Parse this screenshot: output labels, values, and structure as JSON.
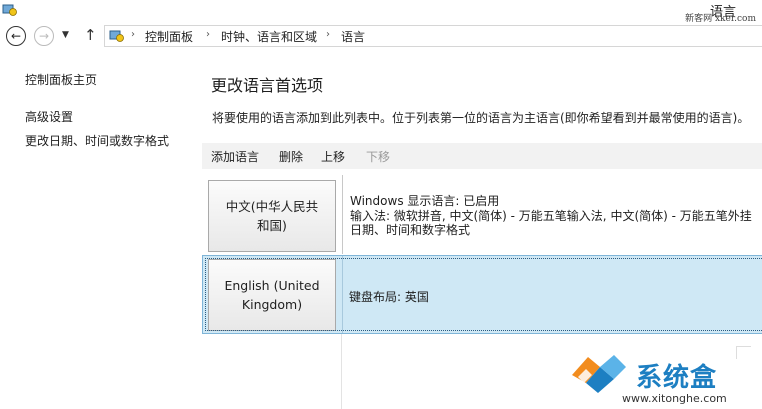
{
  "window": {
    "title": "语言",
    "watermark": "新客网 xker.com"
  },
  "nav": {
    "breadcrumbs": [
      "控制面板",
      "时钟、语言和区域",
      "语言"
    ]
  },
  "sidebar": {
    "home": "控制面板主页",
    "links": [
      "高级设置",
      "更改日期、时间或数字格式"
    ]
  },
  "main": {
    "heading": "更改语言首选项",
    "description": "将要使用的语言添加到此列表中。位于列表第一位的语言为主语言(即你希望看到并最常使用的语言)。",
    "toolbar": {
      "add": "添加语言",
      "remove": "删除",
      "up": "上移",
      "down": "下移"
    },
    "languages": [
      {
        "name_line1": "中文(中华人民共",
        "name_line2": "和国)",
        "info": [
          "Windows 显示语言: 已启用",
          "输入法: 微软拼音, 中文(简体) - 万能五笔输入法, 中文(简体) - 万能五笔外挂",
          "日期、时间和数字格式"
        ],
        "selected": false
      },
      {
        "name_line1": "English (United",
        "name_line2": "Kingdom)",
        "info": [
          "键盘布局: 英国"
        ],
        "selected": true
      }
    ]
  },
  "logo": {
    "text": "系统盒",
    "url": "www.xitonghe.com"
  },
  "colors": {
    "selection": "#cfe8f5",
    "logo_blue": "#1d7fc2",
    "logo_orange": "#f28c1e"
  }
}
